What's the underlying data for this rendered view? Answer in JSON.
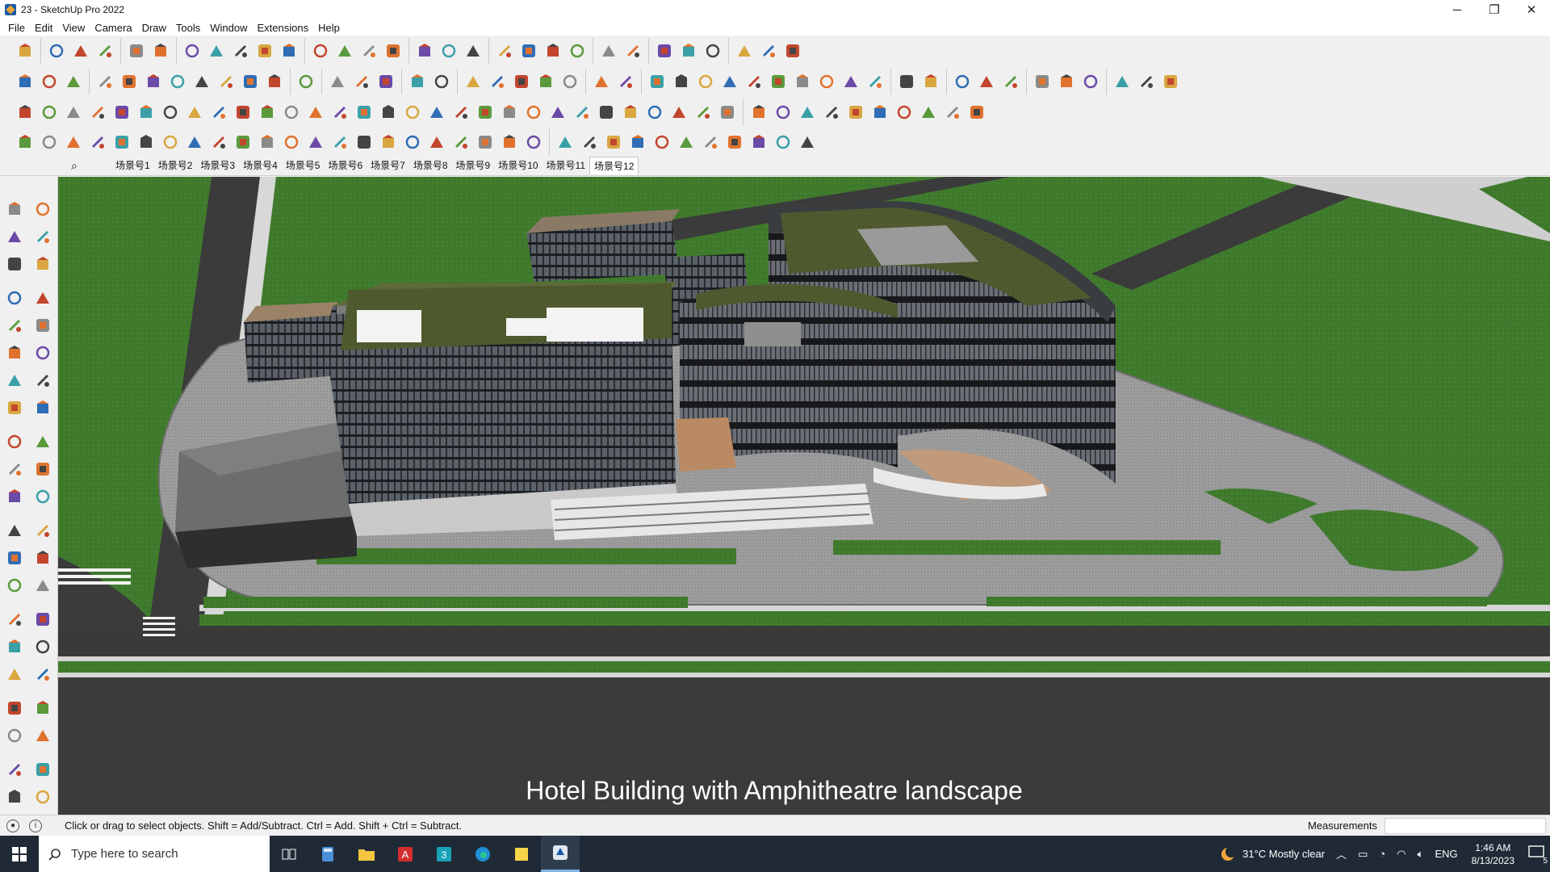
{
  "window": {
    "title": "23 - SketchUp Pro 2022",
    "controls": {
      "minimize": "─",
      "maximize": "❐",
      "close": "✕"
    }
  },
  "menu": [
    "File",
    "Edit",
    "View",
    "Camera",
    "Draw",
    "Tools",
    "Window",
    "Extensions",
    "Help"
  ],
  "scenes": {
    "tabs": [
      "场景号1",
      "场景号2",
      "场景号3",
      "场景号4",
      "场景号5",
      "场景号6",
      "场景号7",
      "场景号8",
      "场景号9",
      "场景号10",
      "场景号11",
      "场景号12"
    ],
    "active_index": 11
  },
  "viewport": {
    "caption": "Hotel Building with Amphitheatre landscape"
  },
  "status": {
    "hint": "Click or drag to select objects. Shift = Add/Subtract. Ctrl = Add. Shift + Ctrl = Subtract.",
    "measurements_label": "Measurements",
    "measurements_value": ""
  },
  "taskbar": {
    "search_placeholder": "Type here to search",
    "weather": "31°C  Mostly clear",
    "language": "ENG",
    "time": "1:46 AM",
    "date": "8/13/2023",
    "notification_count": "5"
  },
  "colors": {
    "grass": "#3f7a2c",
    "road": "#3b3b3b",
    "taskbar": "#1f2a36",
    "accent": "#1a5aa6"
  }
}
